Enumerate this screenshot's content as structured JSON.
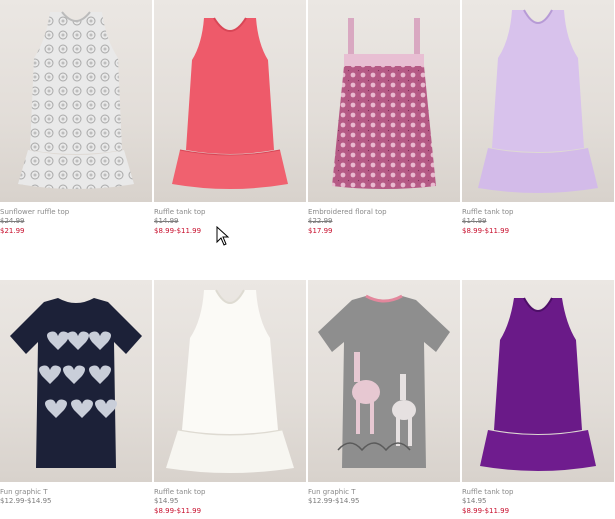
{
  "products": [
    {
      "name": "Sunflower ruffle top",
      "original_price": "$24.99",
      "sale_price": "$21.99",
      "icon": "sunflower-ruffle-top-image"
    },
    {
      "name": "Ruffle tank top",
      "original_price": "$14.99",
      "sale_price": "$8.99-$11.99",
      "icon": "pink-ruffle-tank-image"
    },
    {
      "name": "Embroidered floral top",
      "original_price": "$22.99",
      "sale_price": "$17.99",
      "icon": "embroidered-floral-top-image"
    },
    {
      "name": "Ruffle tank top",
      "original_price": "$14.99",
      "sale_price": "$8.99-$11.99",
      "icon": "lavender-ruffle-tank-image"
    },
    {
      "name": "Fun graphic T",
      "original_price": "$12.99-$14.95",
      "sale_price": "",
      "icon": "navy-heart-graphic-tee-image"
    },
    {
      "name": "Ruffle tank top",
      "original_price": "$14.95",
      "sale_price": "$8.99-$11.99",
      "icon": "white-ruffle-tank-image"
    },
    {
      "name": "Fun graphic T",
      "original_price": "$12.99-$14.95",
      "sale_price": "",
      "icon": "grey-giraffe-graphic-tee-image"
    },
    {
      "name": "Ruffle tank top",
      "original_price": "$14.95",
      "sale_price": "$8.99-$11.99",
      "icon": "purple-ruffle-tank-image"
    }
  ],
  "colors": {
    "sale": "#c8102e",
    "text": "#8a8a8a",
    "pink_tank": "#ee5a6a",
    "lavender_tank": "#d8c2ec",
    "navy_tee": "#1c2138",
    "white_tank": "#fbfaf6",
    "grey_tee": "#8e8e8e",
    "purple_tank": "#6a1a88"
  }
}
